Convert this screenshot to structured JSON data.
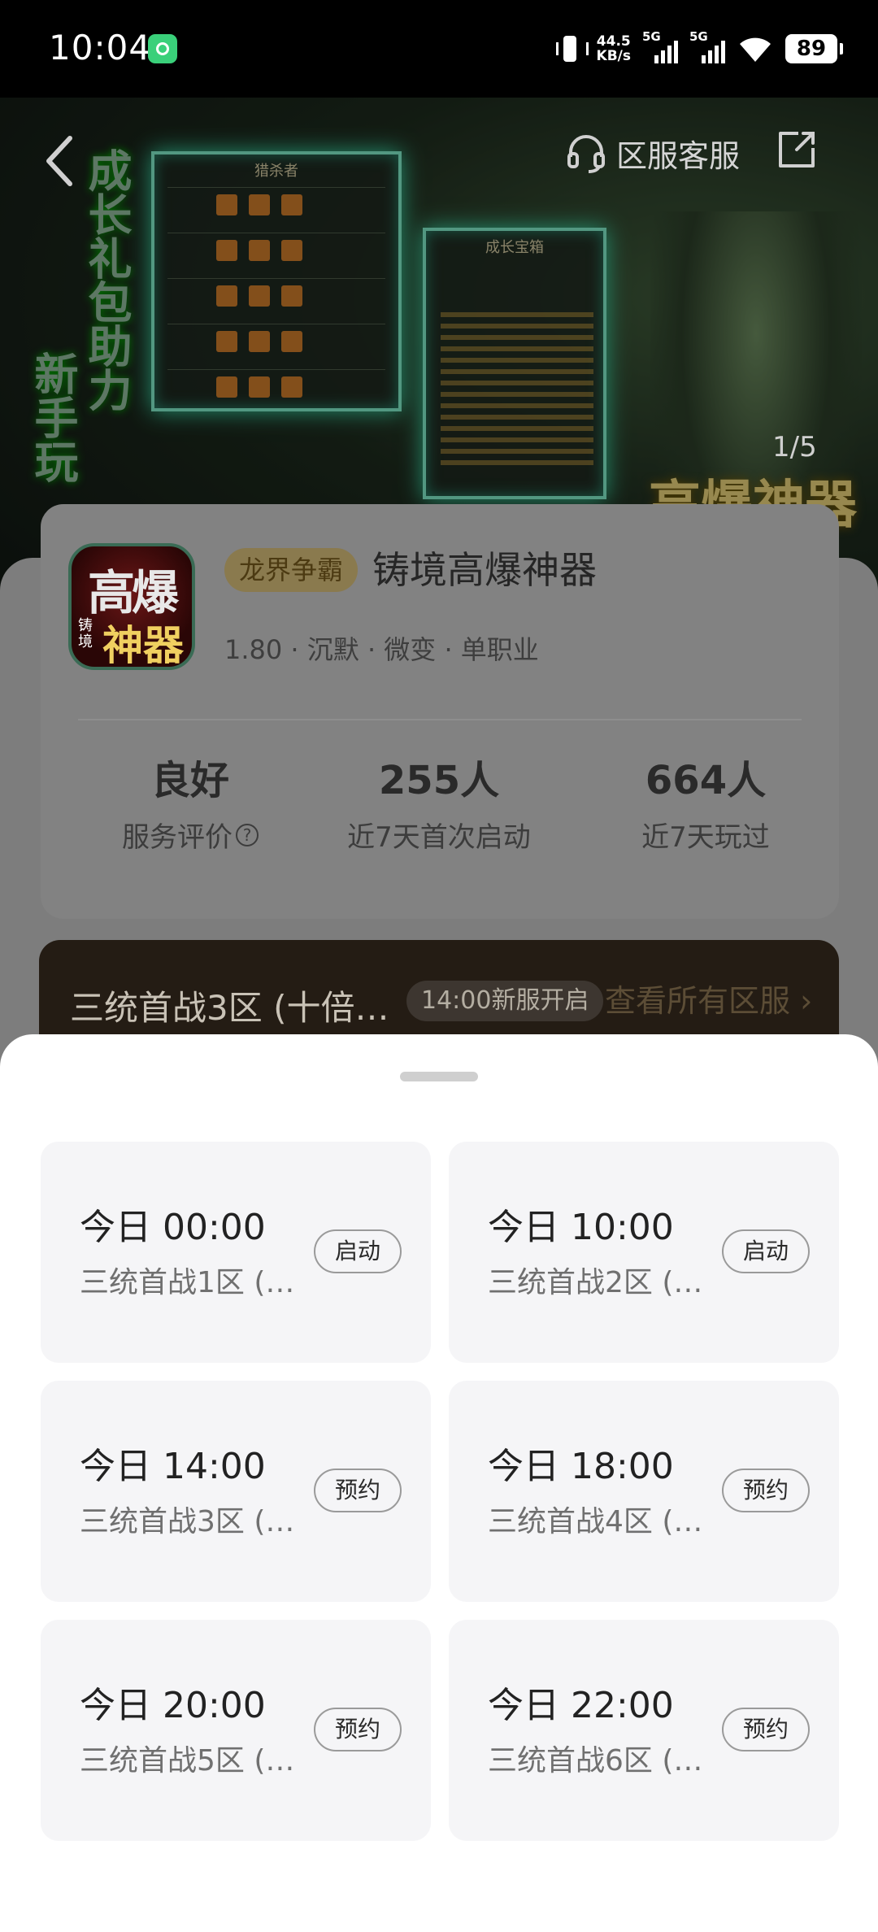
{
  "status_bar": {
    "time": "10:04",
    "net_speed_value": "44.5",
    "net_speed_unit": "KB/s",
    "sim1": "5G",
    "sim2": "5G",
    "battery": "89"
  },
  "hero": {
    "vertical_text_1": "成长礼包助力",
    "vertical_text_2": "新手玩",
    "panel1_title": "猎杀者",
    "panel2_title": "成长宝箱",
    "brand_text": "高爆神器",
    "customer_service_label": "区服客服",
    "image_counter": "1/5"
  },
  "game": {
    "tag": "龙界争霸",
    "title": "铸境高爆神器",
    "meta": "1.80 · 沉默 · 微变 · 单职业",
    "icon_text_top": "高爆",
    "icon_text_bottom": "神器",
    "icon_text_side": "铸境"
  },
  "stats": [
    {
      "value": "良好",
      "label": "服务评价"
    },
    {
      "value": "255人",
      "label": "近7天首次启动"
    },
    {
      "value": "664人",
      "label": "近7天玩过"
    }
  ],
  "server_bar": {
    "current_server": "三统首战3区 (十倍…",
    "open_time_chip": "14:00新服开启",
    "view_all_link": "查看所有区服 ›"
  },
  "server_list": [
    {
      "time": "今日 00:00",
      "server": "三统首战1区 (…",
      "action": "启动"
    },
    {
      "time": "今日 10:00",
      "server": "三统首战2区 (…",
      "action": "启动"
    },
    {
      "time": "今日 14:00",
      "server": "三统首战3区 (…",
      "action": "预约"
    },
    {
      "time": "今日 18:00",
      "server": "三统首战4区 (…",
      "action": "预约"
    },
    {
      "time": "今日 20:00",
      "server": "三统首战5区 (…",
      "action": "预约"
    },
    {
      "time": "今日 22:00",
      "server": "三统首战6区 (…",
      "action": "预约"
    }
  ],
  "colors": {
    "status_bar_bg": "#000000",
    "overlay_grey": "#7d7d7d",
    "sheet_bg": "#ffffff",
    "card_bg": "#f5f5f7",
    "tag_bg": "#8a7a4e",
    "server_bar_bg": "#241c14"
  }
}
